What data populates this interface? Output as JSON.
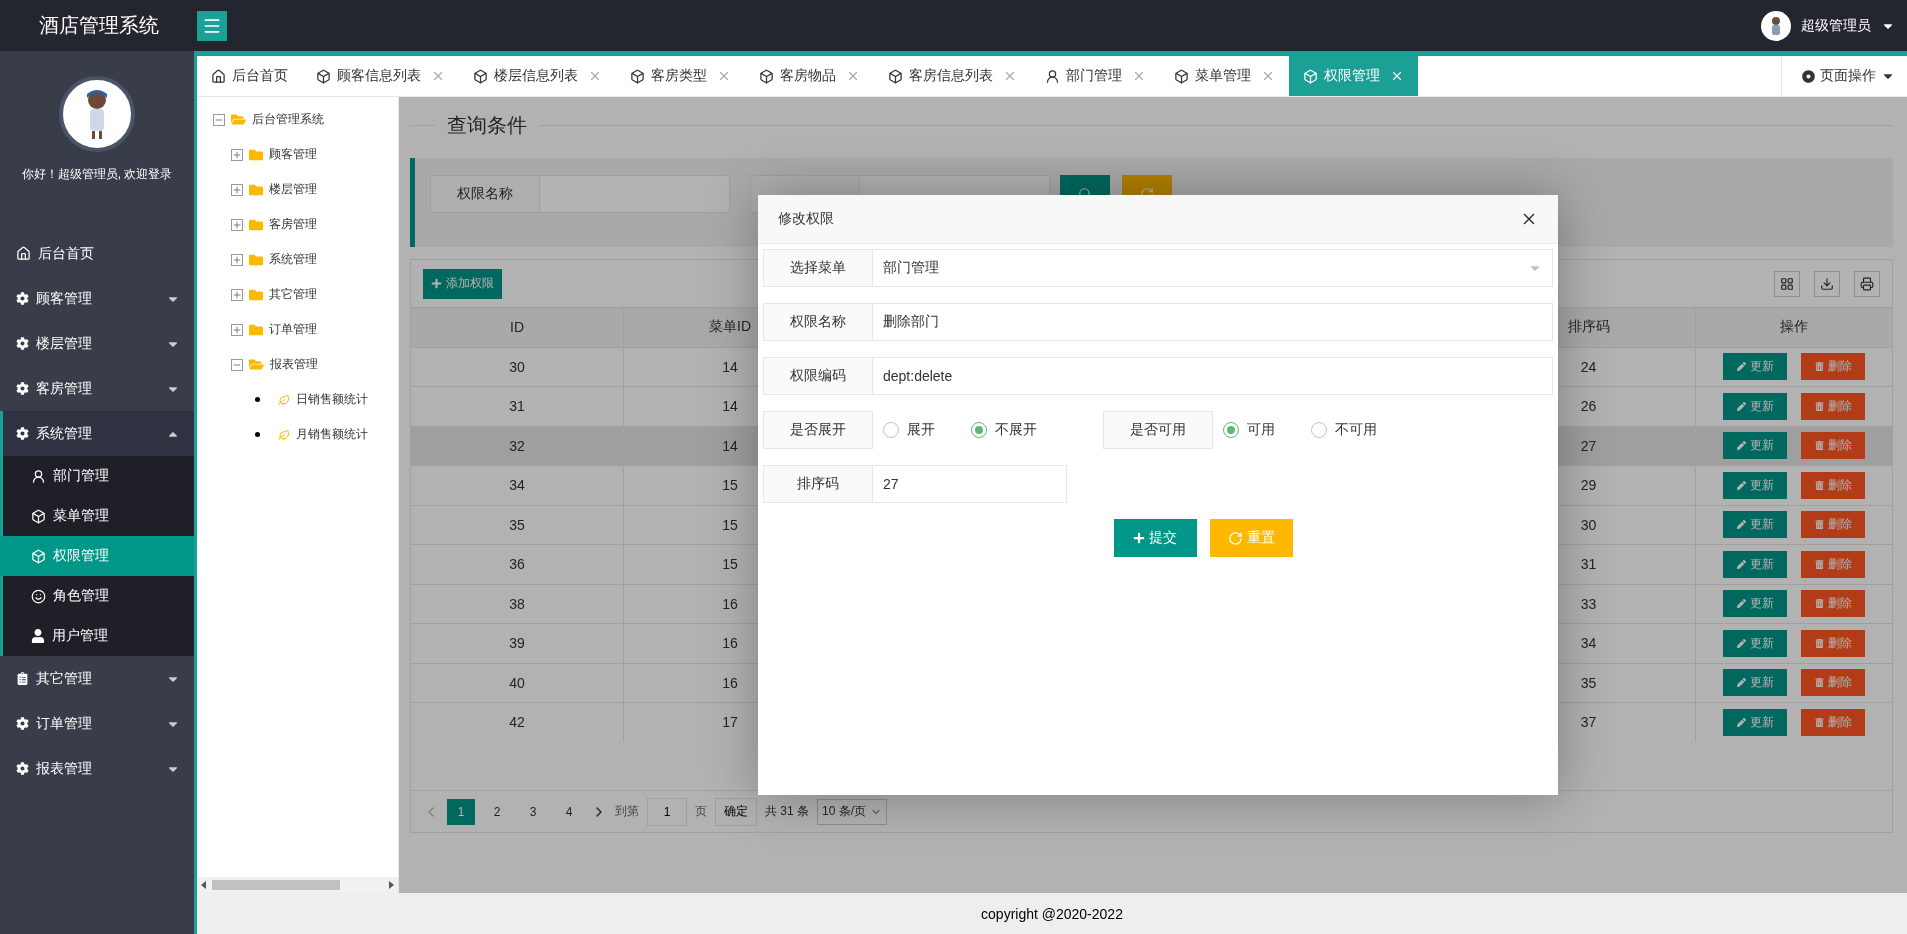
{
  "topbar": {
    "title": "酒店管理系统",
    "user": "超级管理员"
  },
  "sidebar": {
    "greeting": "你好！超级管理员, 欢迎登录",
    "items": [
      {
        "label": "后台首页",
        "kind": "link"
      },
      {
        "label": "顾客管理",
        "kind": "group",
        "expanded": false
      },
      {
        "label": "楼层管理",
        "kind": "group",
        "expanded": false
      },
      {
        "label": "客房管理",
        "kind": "group",
        "expanded": false
      },
      {
        "label": "系统管理",
        "kind": "group",
        "expanded": true,
        "children": [
          {
            "label": "部门管理",
            "selected": false
          },
          {
            "label": "菜单管理",
            "selected": false
          },
          {
            "label": "权限管理",
            "selected": true
          },
          {
            "label": "角色管理",
            "selected": false
          },
          {
            "label": "用户管理",
            "selected": false
          }
        ]
      },
      {
        "label": "其它管理",
        "kind": "group",
        "expanded": false
      },
      {
        "label": "订单管理",
        "kind": "group",
        "expanded": false
      },
      {
        "label": "报表管理",
        "kind": "group",
        "expanded": false
      }
    ]
  },
  "tabs": [
    {
      "label": "后台首页",
      "closable": false,
      "selected": false
    },
    {
      "label": "顾客信息列表",
      "closable": true,
      "selected": false
    },
    {
      "label": "楼层信息列表",
      "closable": true,
      "selected": false
    },
    {
      "label": "客房类型",
      "closable": true,
      "selected": false
    },
    {
      "label": "客房物品",
      "closable": true,
      "selected": false
    },
    {
      "label": "客房信息列表",
      "closable": true,
      "selected": false
    },
    {
      "label": "部门管理",
      "closable": true,
      "selected": false
    },
    {
      "label": "菜单管理",
      "closable": true,
      "selected": false
    },
    {
      "label": "权限管理",
      "closable": true,
      "selected": true
    }
  ],
  "page_actions": "页面操作",
  "tree": {
    "label": "后台管理系统",
    "kind": "folder",
    "expanded": true,
    "children": [
      {
        "label": "顾客管理",
        "kind": "folder",
        "expanded": false
      },
      {
        "label": "楼层管理",
        "kind": "folder",
        "expanded": false
      },
      {
        "label": "客房管理",
        "kind": "folder",
        "expanded": false
      },
      {
        "label": "系统管理",
        "kind": "folder",
        "expanded": false
      },
      {
        "label": "其它管理",
        "kind": "folder",
        "expanded": false
      },
      {
        "label": "订单管理",
        "kind": "folder",
        "expanded": false
      },
      {
        "label": "报表管理",
        "kind": "folder",
        "expanded": true,
        "children": [
          {
            "label": "日销售额统计",
            "kind": "leaf"
          },
          {
            "label": "月销售额统计",
            "kind": "leaf"
          }
        ]
      }
    ]
  },
  "query": {
    "legend": "查询条件",
    "fields": [
      {
        "kind": "labeled",
        "label": "权限名称"
      },
      {
        "kind": "covered"
      }
    ],
    "buttons": [
      {
        "kind": "search"
      },
      {
        "kind": "reset"
      }
    ]
  },
  "toolbar": {
    "add": "添加权限"
  },
  "table": {
    "columns": [
      "ID",
      "菜单ID",
      "排序码",
      "操作"
    ],
    "rows": [
      {
        "cells": [
          "30",
          "14",
          "24"
        ],
        "actions": [
          "更新",
          "删除"
        ],
        "hovered": false
      },
      {
        "cells": [
          "31",
          "14",
          "26"
        ],
        "actions": [
          "更新",
          "删除"
        ],
        "hovered": false
      },
      {
        "cells": [
          "32",
          "14",
          "27"
        ],
        "actions": [
          "更新",
          "删除"
        ],
        "hovered": true
      },
      {
        "cells": [
          "34",
          "15",
          "29"
        ],
        "actions": [
          "更新",
          "删除"
        ],
        "hovered": false
      },
      {
        "cells": [
          "35",
          "15",
          "30"
        ],
        "actions": [
          "更新",
          "删除"
        ],
        "hovered": false
      },
      {
        "cells": [
          "36",
          "15",
          "31"
        ],
        "actions": [
          "更新",
          "删除"
        ],
        "hovered": false
      },
      {
        "cells": [
          "38",
          "16",
          "33"
        ],
        "actions": [
          "更新",
          "删除"
        ],
        "hovered": false
      },
      {
        "cells": [
          "39",
          "16",
          "34"
        ],
        "actions": [
          "更新",
          "删除"
        ],
        "hovered": false
      },
      {
        "cells": [
          "40",
          "16",
          "35"
        ],
        "actions": [
          "更新",
          "删除"
        ],
        "hovered": false
      },
      {
        "cells": [
          "42",
          "17",
          "37"
        ],
        "actions": [
          "更新",
          "删除"
        ],
        "hovered": false
      }
    ]
  },
  "pagination": {
    "pages": [
      {
        "label": "1",
        "selected": true
      },
      {
        "label": "2",
        "selected": false
      },
      {
        "label": "3",
        "selected": false
      },
      {
        "label": "4",
        "selected": false
      }
    ],
    "goto_label": "到第",
    "goto_value": "1",
    "page_unit": "页",
    "confirm": "确定",
    "total": "共 31 条",
    "page_size": "10 条/页"
  },
  "dialog": {
    "title": "修改权限",
    "rows": [
      {
        "kind": "select",
        "label": "选择菜单",
        "value": "部门管理"
      },
      {
        "kind": "text",
        "label": "权限名称",
        "value": "删除部门"
      },
      {
        "kind": "text",
        "label": "权限编码",
        "value": "dept:delete"
      },
      {
        "kind": "radios",
        "groups": [
          {
            "label": "是否展开",
            "options": [
              {
                "label": "展开",
                "selected": false
              },
              {
                "label": "不展开",
                "selected": true
              }
            ]
          },
          {
            "label": "是否可用",
            "options": [
              {
                "label": "可用",
                "selected": true
              },
              {
                "label": "不可用",
                "selected": false
              }
            ]
          }
        ]
      },
      {
        "kind": "short",
        "label": "排序码",
        "value": "27"
      }
    ],
    "buttons": [
      {
        "label": "提交",
        "kind": "submit"
      },
      {
        "label": "重置",
        "kind": "reset"
      }
    ]
  },
  "footer": "copyright @2020-2022"
}
